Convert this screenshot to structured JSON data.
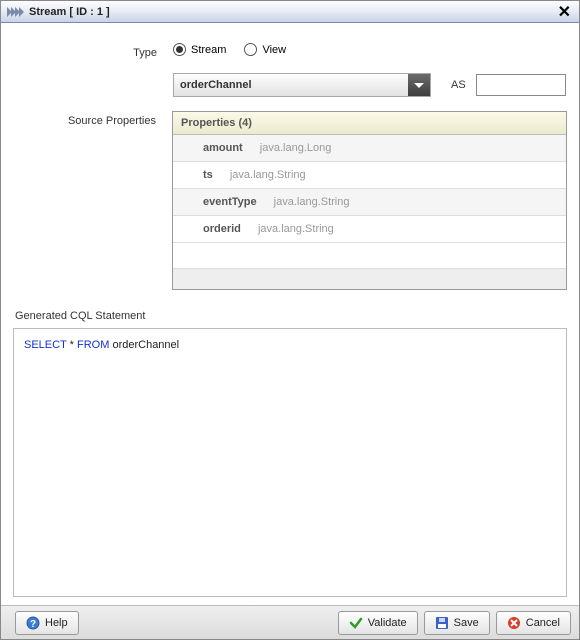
{
  "titlebar": {
    "title": "Stream [ ID : 1 ]"
  },
  "labels": {
    "type": "Type",
    "source_properties": "Source Properties",
    "as": "AS",
    "generated_cql": "Generated CQL Statement"
  },
  "type_radios": {
    "stream": "Stream",
    "view": "View",
    "selected": "stream"
  },
  "source_select": {
    "value": "orderChannel"
  },
  "as_input": {
    "value": ""
  },
  "properties": {
    "header": "Properties (4)",
    "rows": [
      {
        "name": "amount",
        "type": "java.lang.Long"
      },
      {
        "name": "ts",
        "type": "java.lang.String"
      },
      {
        "name": "eventType",
        "type": "java.lang.String"
      },
      {
        "name": "orderid",
        "type": "java.lang.String"
      }
    ]
  },
  "cql": {
    "kw_select": "SELECT",
    "star": "*",
    "kw_from": "FROM",
    "table": "orderChannel"
  },
  "buttons": {
    "help": "Help",
    "validate": "Validate",
    "save": "Save",
    "cancel": "Cancel"
  }
}
